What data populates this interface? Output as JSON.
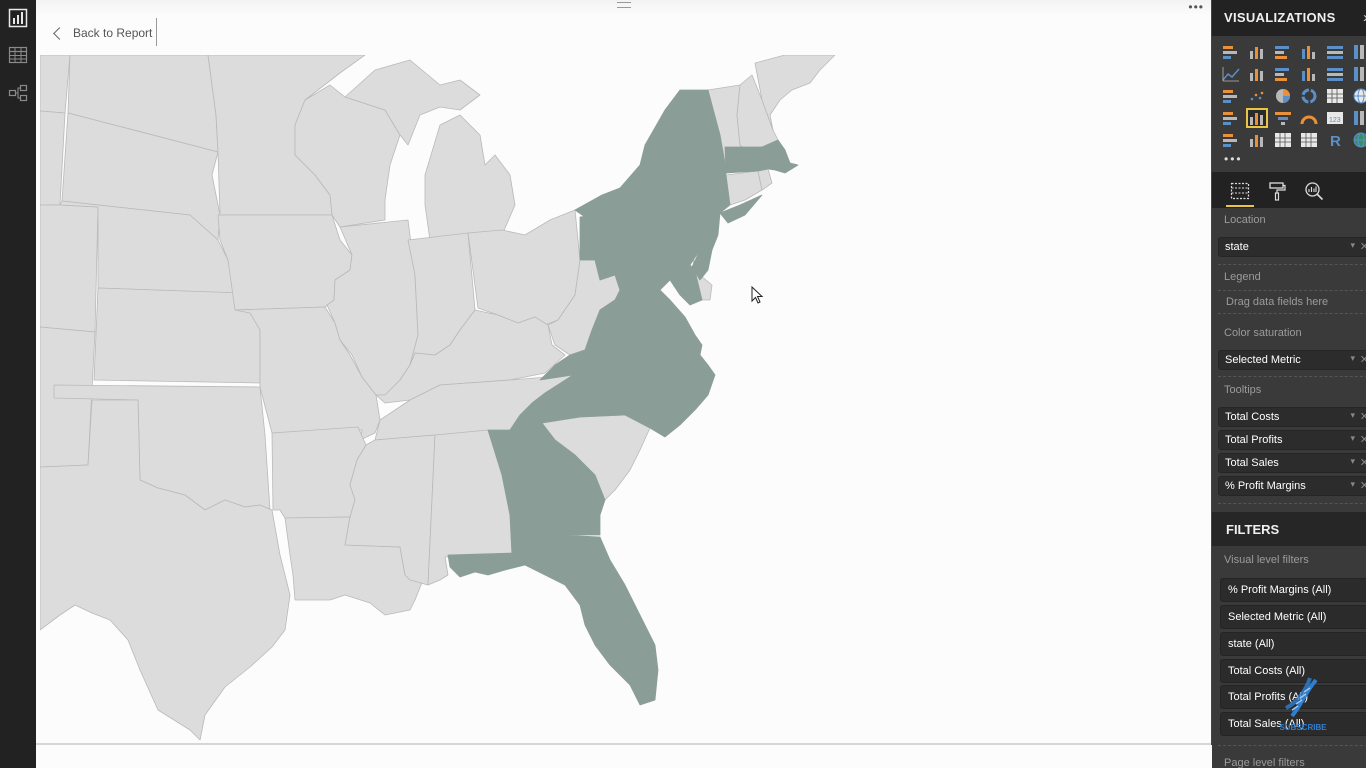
{
  "app": {
    "left_nav": [
      {
        "name": "report-view",
        "icon": "bar-chart-icon"
      },
      {
        "name": "data-view",
        "icon": "table-icon"
      },
      {
        "name": "relationships-view",
        "icon": "relationships-icon"
      }
    ]
  },
  "canvas": {
    "back_label": "Back to Report",
    "more_icon": "•••"
  },
  "map": {
    "highlight_color": "#8a9e97",
    "base_color": "#dcdcdc",
    "border_color": "#b9b9b9",
    "highlighted_states": [
      "New York",
      "Pennsylvania",
      "New Jersey",
      "Massachusetts",
      "Maryland",
      "Virginia",
      "North Carolina",
      "Georgia",
      "Florida"
    ]
  },
  "visualizations": {
    "title": "VISUALIZATIONS",
    "collapse_icon": "›",
    "more_label": "•••",
    "icons": [
      "stacked-bar-chart-icon",
      "stacked-column-chart-icon",
      "clustered-bar-chart-icon",
      "clustered-column-chart-icon",
      "100-stacked-bar-chart-icon",
      "100-stacked-column-chart-icon",
      "line-chart-icon",
      "area-chart-icon",
      "stacked-area-chart-icon",
      "line-and-stacked-column-icon",
      "line-and-clustered-column-icon",
      "ribbon-chart-icon",
      "waterfall-chart-icon",
      "scatter-chart-icon",
      "pie-chart-icon",
      "donut-chart-icon",
      "treemap-icon",
      "map-icon",
      "filled-map-icon",
      "shape-map-icon",
      "funnel-icon",
      "gauge-icon",
      "card-icon",
      "multi-row-card-icon",
      "kpi-icon",
      "slicer-icon",
      "table-icon",
      "matrix-icon",
      "r-script-icon",
      "globe-map-icon"
    ],
    "selected_index": 19,
    "tabs": [
      {
        "name": "fields-tab",
        "icon": "fields-icon",
        "active": true
      },
      {
        "name": "format-tab",
        "icon": "paint-roller-icon",
        "active": false
      },
      {
        "name": "analytics-tab",
        "icon": "analytics-icon",
        "active": false
      }
    ],
    "wells": {
      "location_label": "Location",
      "location_field": "state",
      "legend_label": "Legend",
      "legend_placeholder": "Drag data fields here",
      "color_saturation_label": "Color saturation",
      "color_saturation_field": "Selected Metric",
      "tooltips_label": "Tooltips",
      "tooltips": [
        "Total Costs",
        "Total Profits",
        "Total Sales",
        "% Profit Margins"
      ]
    },
    "dropdown_glyph": "▾",
    "remove_glyph": "✕"
  },
  "filters": {
    "title": "FILTERS",
    "visual_level_label": "Visual level filters",
    "visual_level": [
      "% Profit Margins  (All)",
      "Selected Metric  (All)",
      "state  (All)",
      "Total Costs  (All)",
      "Total Profits  (All)",
      "Total Sales  (All)"
    ],
    "page_level_label": "Page level filters"
  },
  "watermark": {
    "label": "SUBSCRIBE"
  }
}
